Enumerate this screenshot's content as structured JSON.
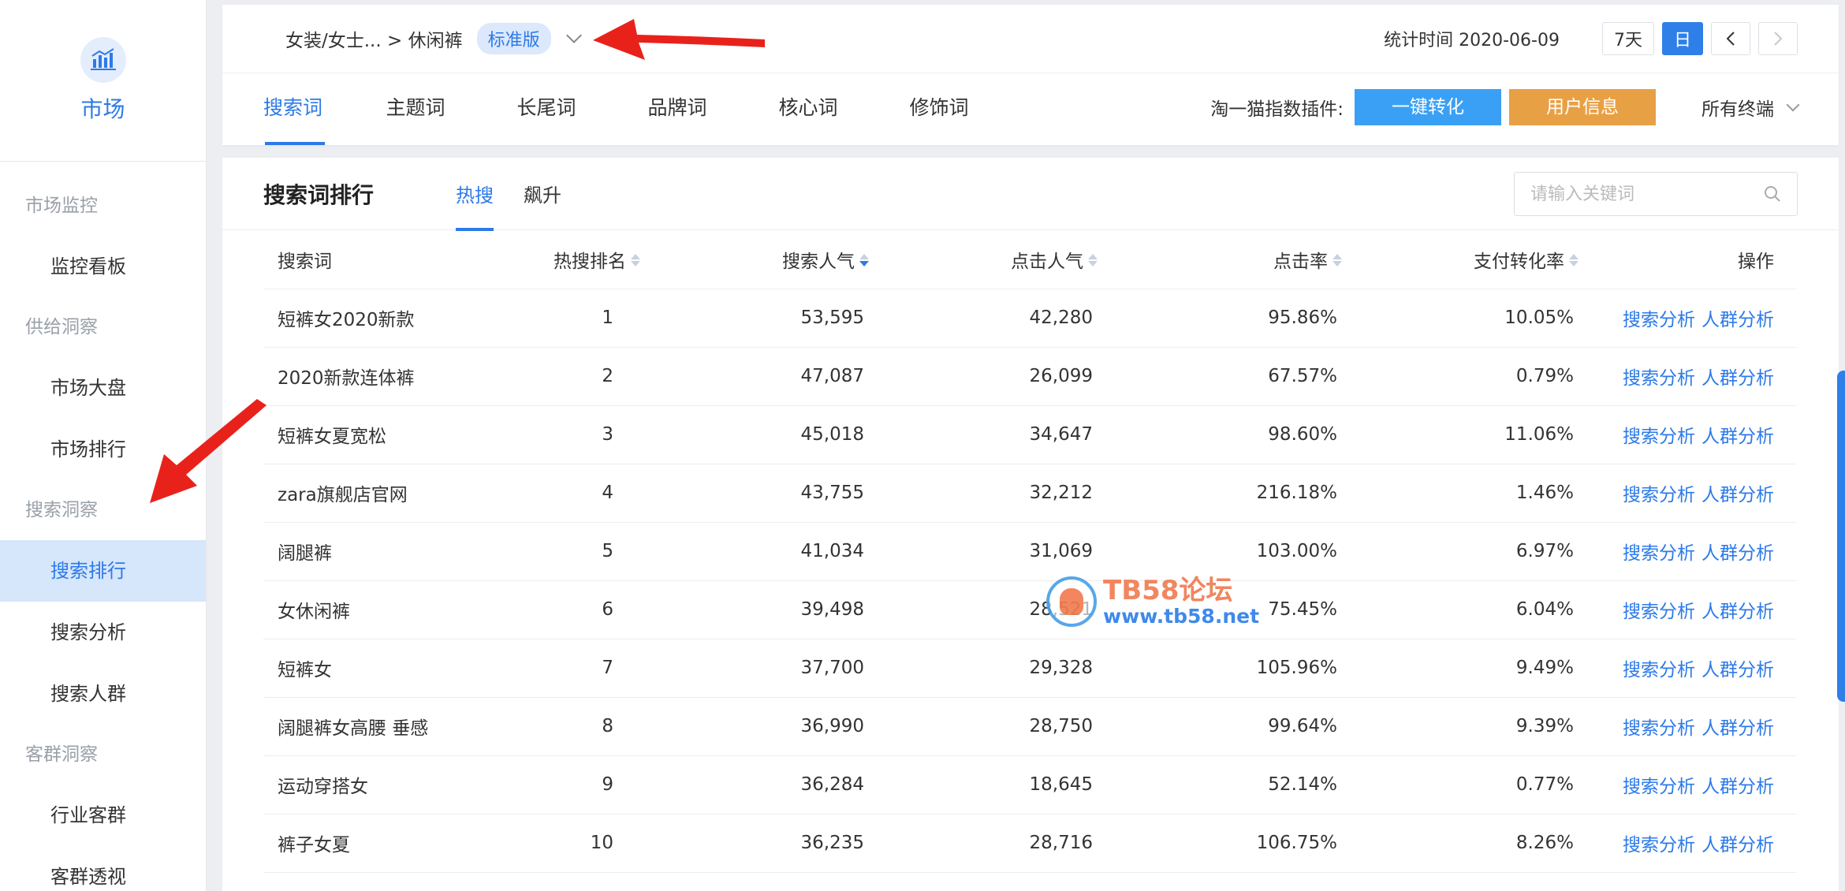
{
  "sidebar": {
    "brand_label": "市场",
    "brand_icon": "chart-building-icon",
    "groups": [
      {
        "label": "市场监控",
        "items": [
          {
            "label": "监控看板",
            "active": false
          }
        ]
      },
      {
        "label": "供给洞察",
        "items": [
          {
            "label": "市场大盘",
            "active": false
          },
          {
            "label": "市场排行",
            "active": false
          }
        ]
      },
      {
        "label": "搜索洞察",
        "items": [
          {
            "label": "搜索排行",
            "active": true
          },
          {
            "label": "搜索分析",
            "active": false
          },
          {
            "label": "搜索人群",
            "active": false
          }
        ]
      },
      {
        "label": "客群洞察",
        "items": [
          {
            "label": "行业客群",
            "active": false
          },
          {
            "label": "客群透视",
            "active": false
          }
        ]
      }
    ]
  },
  "header": {
    "breadcrumb": "女装/女士... > 休闲裤",
    "badge": "标准版",
    "stat_time": "统计时间 2020-06-09",
    "btn_7d": "7天",
    "btn_day": "日",
    "prev": "‹",
    "next": "›",
    "tabs": [
      "搜索词",
      "主题词",
      "长尾词",
      "品牌词",
      "核心词",
      "修饰词"
    ],
    "active_tab": 0,
    "plugin_label": "淘一猫指数插件:",
    "btn_convert": "一键转化",
    "btn_userinfo": "用户信息",
    "terminal": "所有终端"
  },
  "main": {
    "title": "搜索词排行",
    "subtabs": [
      "热搜",
      "飙升"
    ],
    "active_subtab": 0,
    "search_placeholder": "请输入关键词",
    "columns": [
      "搜索词",
      "热搜排名",
      "搜索人气",
      "点击人气",
      "点击率",
      "支付转化率",
      "操作"
    ],
    "rows": [
      [
        "短裤女2020新款",
        "1",
        "53,595",
        "42,280",
        "95.86%",
        "10.05%"
      ],
      [
        "2020新款连体裤",
        "2",
        "47,087",
        "26,099",
        "67.57%",
        "0.79%"
      ],
      [
        "短裤女夏宽松",
        "3",
        "45,018",
        "34,647",
        "98.60%",
        "11.06%"
      ],
      [
        "zara旗舰店官网",
        "4",
        "43,755",
        "32,212",
        "216.18%",
        "1.46%"
      ],
      [
        "阔腿裤",
        "5",
        "41,034",
        "31,069",
        "103.00%",
        "6.97%"
      ],
      [
        "女休闲裤",
        "6",
        "39,498",
        "28,521",
        "75.45%",
        "6.04%"
      ],
      [
        "短裤女",
        "7",
        "37,700",
        "29,328",
        "105.96%",
        "9.49%"
      ],
      [
        "阔腿裤女高腰 垂感",
        "8",
        "36,990",
        "28,750",
        "99.64%",
        "9.39%"
      ],
      [
        "运动穿搭女",
        "9",
        "36,284",
        "18,645",
        "52.14%",
        "0.77%"
      ],
      [
        "裤子女夏",
        "10",
        "36,235",
        "28,716",
        "106.75%",
        "8.26%"
      ]
    ],
    "action_1": "搜索分析",
    "action_2": "人群分析"
  },
  "watermark": {
    "line1": "TB58论坛",
    "line2": "www.tb58.net"
  },
  "colors": {
    "accent": "#2c7ae8",
    "orange": "#e8a045",
    "light_blue": "#3aa0f5",
    "arrow_red": "#e8221b"
  }
}
